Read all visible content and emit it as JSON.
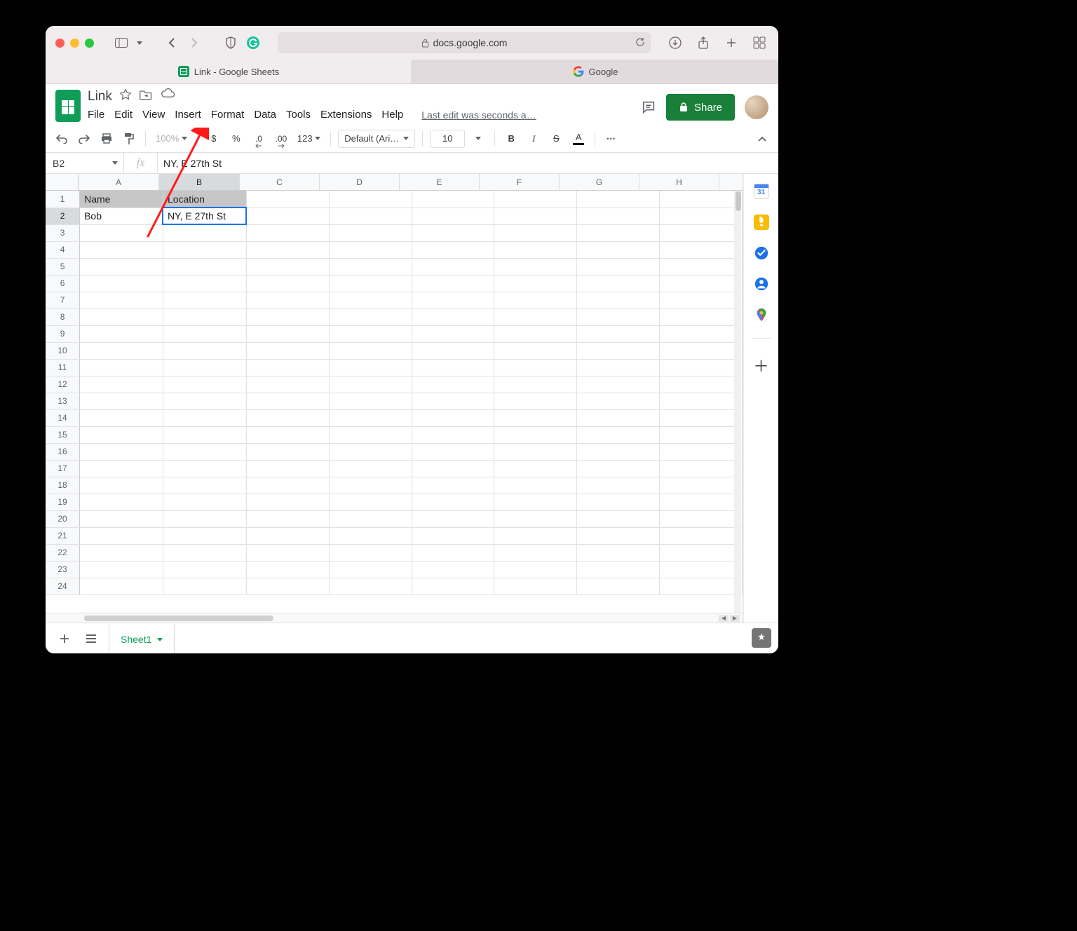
{
  "browser": {
    "url_host": "docs.google.com",
    "tabs": [
      {
        "title": "Link - Google Sheets",
        "active": true
      },
      {
        "title": "Google",
        "active": false
      }
    ]
  },
  "doc": {
    "title": "Link",
    "last_edit": "Last edit was seconds a…",
    "share_label": "Share"
  },
  "menus": {
    "file": "File",
    "edit": "Edit",
    "view": "View",
    "insert": "Insert",
    "format": "Format",
    "data": "Data",
    "tools": "Tools",
    "extensions": "Extensions",
    "help": "Help"
  },
  "toolbar": {
    "zoom": "100%",
    "currency": "$",
    "percent": "%",
    "dec_dec": ".0",
    "inc_dec": ".00",
    "numfmt": "123",
    "font": "Default (Ari…",
    "font_size": "10",
    "bold": "B",
    "italic": "I",
    "strike": "S",
    "textcolor": "A",
    "more": "⋯"
  },
  "cellref": {
    "name": "B2",
    "formula": "NY, E 27th St"
  },
  "columns": [
    "A",
    "B",
    "C",
    "D",
    "E",
    "F",
    "G",
    "H"
  ],
  "rows_shown": 24,
  "selected": {
    "row": 2,
    "col": "B"
  },
  "header_row": {
    "A": "Name",
    "B": "Location"
  },
  "data": {
    "A2": "Bob",
    "B2": "NY, E 27th St"
  },
  "sheet_tab": "Sheet1",
  "sidepanel": [
    "calendar",
    "keep",
    "tasks",
    "contacts",
    "maps"
  ]
}
